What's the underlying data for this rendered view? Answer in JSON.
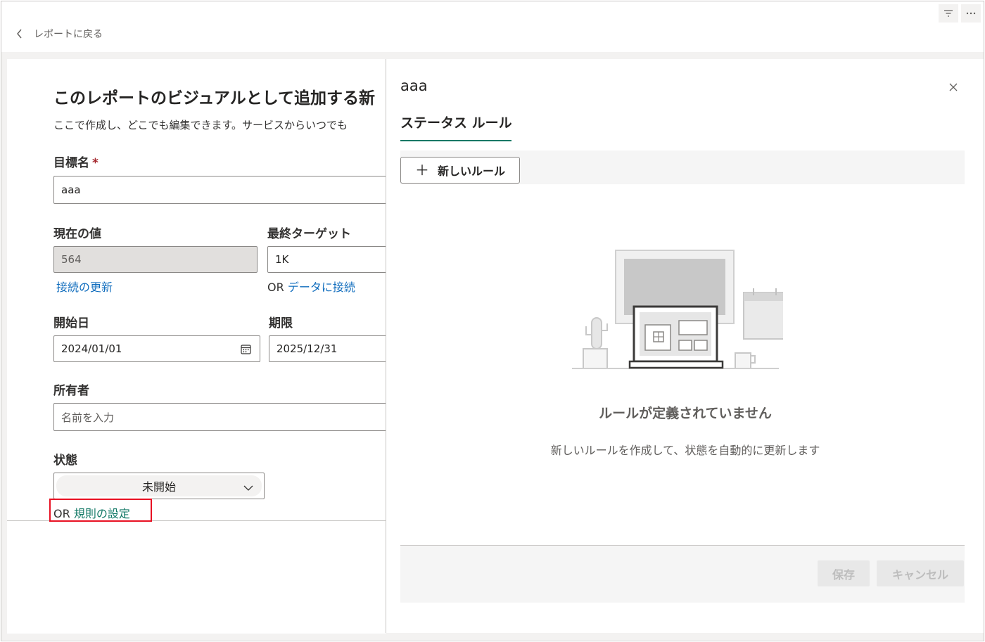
{
  "header": {
    "back_label": "レポートに戻る",
    "icons": [
      "filter-icon",
      "more-icon"
    ]
  },
  "form": {
    "title": "このレポートのビジュアルとして追加する新",
    "description": "ここで作成し、どこでも編集できます。サービスからいつでも",
    "goal_name_label": "目標名",
    "required_mark": "*",
    "goal_name_value": "aaa",
    "current_value_label": "現在の値",
    "current_value": "564",
    "refresh_link": "接続の更新",
    "final_target_label": "最終ターゲット",
    "final_target_value": "1K",
    "or_text": "OR",
    "connect_data_link": "データに接続",
    "start_date_label": "開始日",
    "start_date_value": "2024/01/01",
    "due_date_label": "期限",
    "due_date_value": "2025/12/31",
    "owner_label": "所有者",
    "owner_placeholder": "名前を入力",
    "status_label": "状態",
    "status_value": "未開始",
    "rules_or": "OR",
    "rules_link": "規則の設定"
  },
  "panel": {
    "title": "aaa",
    "tab_label": "ステータス ルール",
    "new_rule_label": "新しいルール",
    "empty_title": "ルールが定義されていません",
    "empty_desc": "新しいルールを作成して、状態を自動的に更新します",
    "save_label": "保存",
    "cancel_label": "キャンセル"
  },
  "colors": {
    "accent_green": "#117865",
    "link_blue": "#0f6cbd",
    "highlight_red": "#e81123"
  }
}
